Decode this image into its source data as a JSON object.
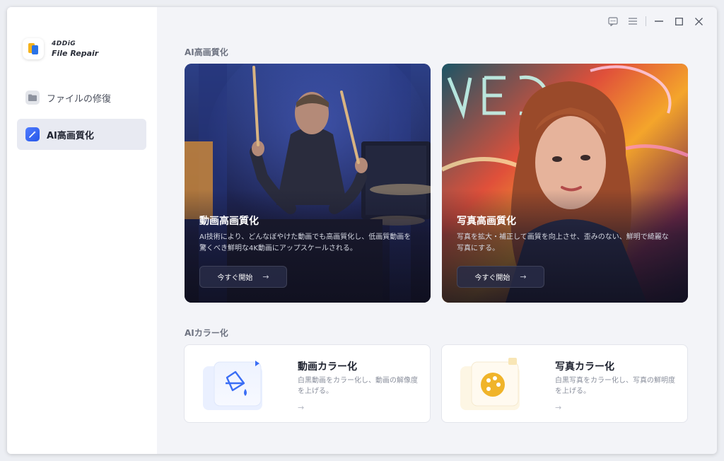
{
  "brand": {
    "line1": "4DDiG",
    "line2": "File Repair"
  },
  "sidebar": {
    "items": [
      {
        "label": "ファイルの修復",
        "icon": "folder-icon",
        "active": false
      },
      {
        "label": "AI高画質化",
        "icon": "magic-wand-icon",
        "active": true
      }
    ]
  },
  "window_controls": [
    "feedback-icon",
    "menu-icon",
    "minimize-icon",
    "maximize-icon",
    "close-icon"
  ],
  "ai_enhance": {
    "section_title": "AI高画質化",
    "cards": [
      {
        "title": "動画高画質化",
        "description": "AI技術により、どんなぼやけた動画でも高画質化し、低画質動画を驚くべき鮮明な4K動画にアップスケールされる。",
        "button": "今すぐ開始",
        "arrow": "→"
      },
      {
        "title": "写真高画質化",
        "description": "写真を拡大・補正して画質を向上させ、歪みのない、鮮明で綺麗な写真にする。",
        "button": "今すぐ開始",
        "arrow": "→"
      }
    ]
  },
  "ai_color": {
    "section_title": "AIカラー化",
    "cards": [
      {
        "title": "動画カラー化",
        "description": "白黒動画をカラー化し、動画の解像度を上げる。",
        "arrow": "→",
        "icon": "paint-bucket-icon"
      },
      {
        "title": "写真カラー化",
        "description": "白黒写真をカラー化し、写真の鮮明度を上げる。",
        "arrow": "→",
        "icon": "palette-icon"
      }
    ]
  },
  "colors": {
    "accent": "#2f62f0",
    "active_nav_bg": "#e8eaf2",
    "background": "#f3f4f8"
  }
}
